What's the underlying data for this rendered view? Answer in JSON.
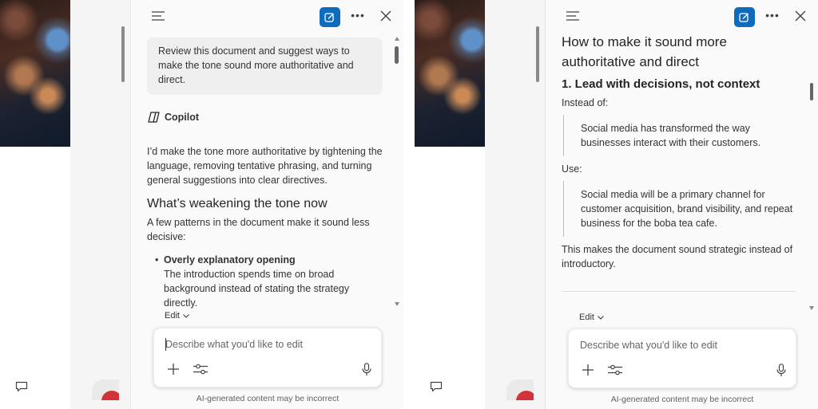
{
  "left_panel": {
    "prompt": "Review this document and suggest ways to make the tone sound more authoritative and direct.",
    "assistant_name": "Copilot",
    "intro": "I’d make the tone more authoritative by tightening the language, removing tentative phrasing, and turning general suggestions into clear directives.",
    "heading": "What’s weakening the tone now",
    "lead": "A few patterns in the document make it sound less decisive:",
    "bullet_title": "Overly explanatory opening",
    "bullet_body": "The introduction spends time on broad background instead of stating the strategy directly.",
    "edit_label": "Edit",
    "input_placeholder": "Describe what you'd like to edit",
    "disclaimer": "AI-generated content may be incorrect"
  },
  "right_panel": {
    "heading": "How to make it sound more authoritative and direct",
    "subheading": "1. Lead with decisions, not context",
    "instead_label": "Instead of:",
    "quote_before": "Social media has transformed the way businesses interact with their customers.",
    "use_label": "Use:",
    "quote_after": "Social media will be a primary channel for customer acquisition, brand visibility, and repeat business for the boba tea cafe.",
    "explanation": "This makes the document sound strategic instead of introductory.",
    "edit_label": "Edit",
    "input_placeholder": "Describe what you'd like to edit",
    "disclaimer": "AI-generated content may be incorrect"
  },
  "icons": [
    "hamburger-menu-icon",
    "new-chat-icon",
    "more-options-icon",
    "close-icon",
    "copilot-logo-icon",
    "chevron-down-icon",
    "plus-icon",
    "sliders-icon",
    "microphone-icon",
    "comment-icon"
  ],
  "colors": {
    "accent": "#0f6cbd",
    "pane_bg": "#fafafa",
    "bubble_bg": "#efefef",
    "record_red": "#d13438"
  }
}
